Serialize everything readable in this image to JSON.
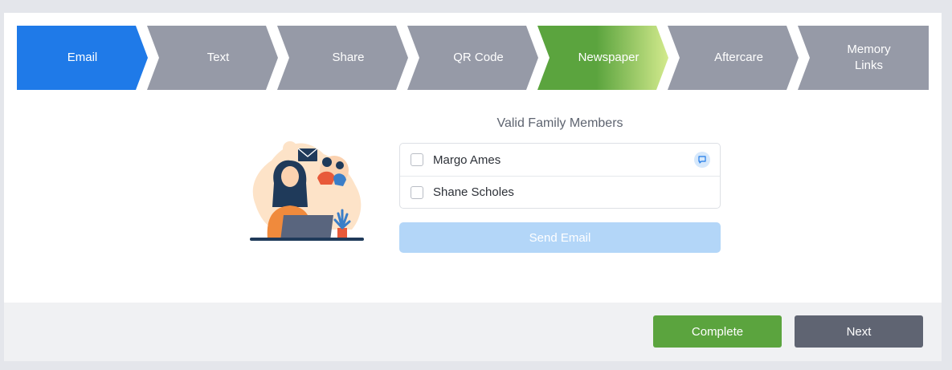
{
  "steps": [
    {
      "label": "Email",
      "state": "active"
    },
    {
      "label": "Text",
      "state": "inactive"
    },
    {
      "label": "Share",
      "state": "inactive"
    },
    {
      "label": "QR Code",
      "state": "inactive"
    },
    {
      "label": "Newspaper",
      "state": "in-progress"
    },
    {
      "label": "Aftercare",
      "state": "inactive"
    },
    {
      "label": "Memory\nLinks",
      "state": "inactive"
    }
  ],
  "panel": {
    "title": "Valid Family Members",
    "members": [
      {
        "name": "Margo Ames",
        "checked": false,
        "has_chat_icon": true
      },
      {
        "name": "Shane Scholes",
        "checked": false,
        "has_chat_icon": false
      }
    ],
    "send_label": "Send Email"
  },
  "footer": {
    "complete_label": "Complete",
    "next_label": "Next"
  },
  "colors": {
    "active_step": "#1f7ae8",
    "inactive_step": "#969aa7",
    "progress_step_start": "#5ba43e",
    "progress_step_end": "#d3ea8d",
    "send_button_disabled": "#b3d6f8",
    "complete_button": "#5ba43e",
    "next_button": "#5f6472"
  },
  "icons": {
    "illustration": "woman-at-laptop-with-family-and-envelope",
    "chat": "chat-bubble-icon"
  }
}
